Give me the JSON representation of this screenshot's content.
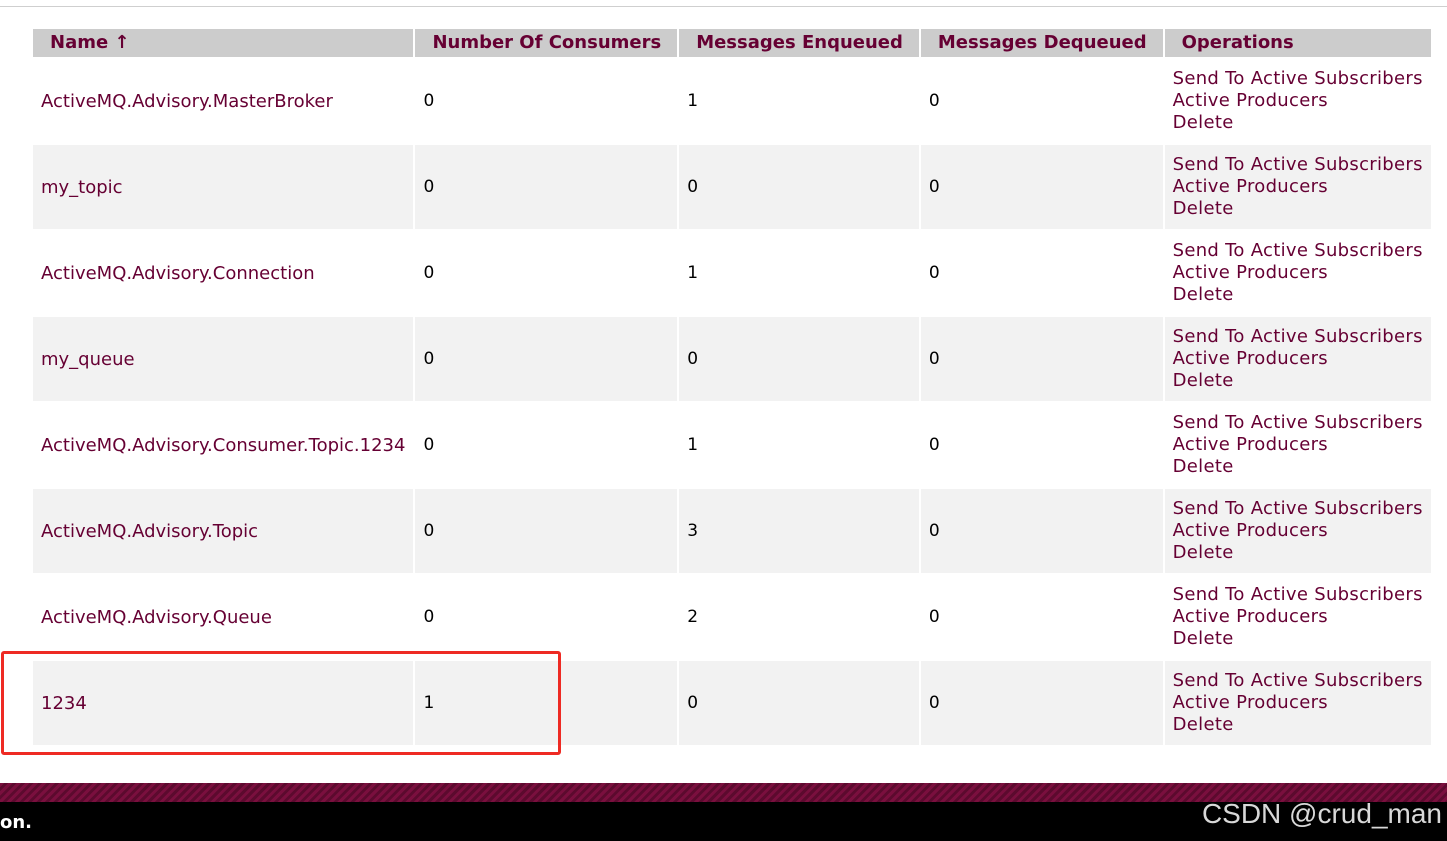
{
  "table": {
    "headers": {
      "name": "Name ↑",
      "consumers": "Number Of Consumers",
      "enqueued": "Messages Enqueued",
      "dequeued": "Messages Dequeued",
      "operations": "Operations"
    },
    "operations": {
      "send": "Send To Active Subscribers",
      "producers": "Active Producers",
      "delete": "Delete"
    },
    "rows": [
      {
        "name": "ActiveMQ.Advisory.MasterBroker",
        "consumers": "0",
        "enqueued": "1",
        "dequeued": "0"
      },
      {
        "name": "my_topic",
        "consumers": "0",
        "enqueued": "0",
        "dequeued": "0"
      },
      {
        "name": "ActiveMQ.Advisory.Connection",
        "consumers": "0",
        "enqueued": "1",
        "dequeued": "0"
      },
      {
        "name": "my_queue",
        "consumers": "0",
        "enqueued": "0",
        "dequeued": "0"
      },
      {
        "name": "ActiveMQ.Advisory.Consumer.Topic.1234",
        "consumers": "0",
        "enqueued": "1",
        "dequeued": "0"
      },
      {
        "name": "ActiveMQ.Advisory.Topic",
        "consumers": "0",
        "enqueued": "3",
        "dequeued": "0"
      },
      {
        "name": "ActiveMQ.Advisory.Queue",
        "consumers": "0",
        "enqueued": "2",
        "dequeued": "0"
      },
      {
        "name": "1234",
        "consumers": "1",
        "enqueued": "0",
        "dequeued": "0"
      }
    ]
  },
  "footer": {
    "text": "on.",
    "watermark": "CSDN @crud_man"
  },
  "colors": {
    "link": "#660033",
    "header_bg": "#cccccc",
    "highlight_box": "#ee2a23"
  }
}
